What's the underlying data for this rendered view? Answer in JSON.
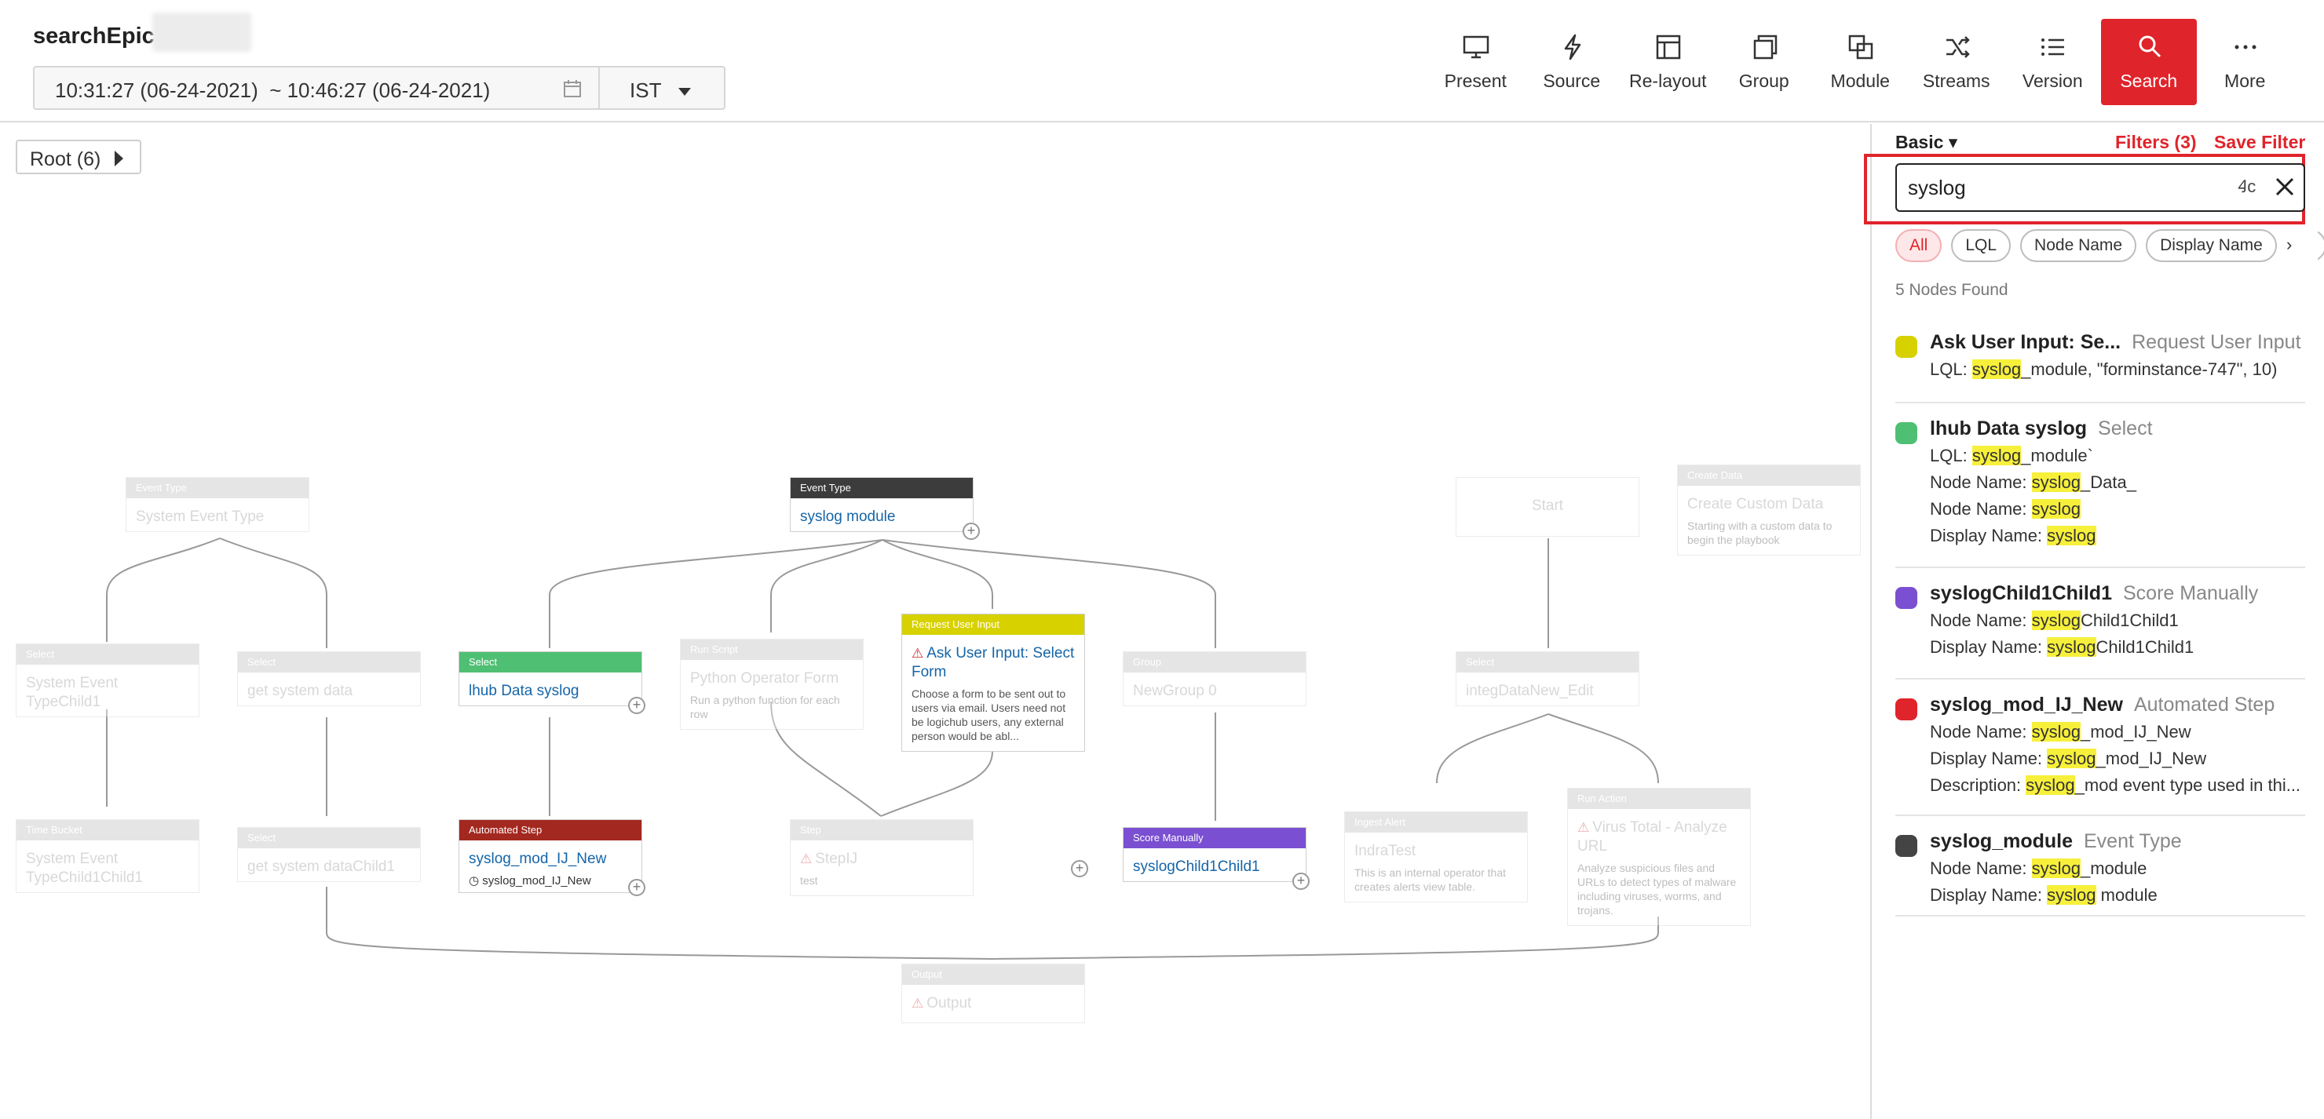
{
  "header": {
    "title": "searchEpic",
    "time_range": "10:31:27 (06-24-2021)  ~ 10:46:27 (06-24-2021)",
    "timezone": "IST",
    "toolbar": [
      {
        "label": "Present",
        "icon": "monitor-icon"
      },
      {
        "label": "Source",
        "icon": "bolt-icon"
      },
      {
        "label": "Re-layout",
        "icon": "layout-icon"
      },
      {
        "label": "Group",
        "icon": "group-icon"
      },
      {
        "label": "Module",
        "icon": "module-icon"
      },
      {
        "label": "Streams",
        "icon": "shuffle-icon"
      },
      {
        "label": "Version",
        "icon": "list-icon"
      },
      {
        "label": "Search",
        "icon": "search-icon",
        "active": true
      },
      {
        "label": "More",
        "icon": "more-icon"
      }
    ]
  },
  "canvas": {
    "breadcrumb": "Root (6)",
    "nodes": {
      "system_event_type": {
        "head": "Event Type",
        "title": "System Event Type"
      },
      "syslog_module": {
        "head": "Event Type",
        "title": "syslog module"
      },
      "start": {
        "title": "Start"
      },
      "create_data": {
        "head": "Create Data",
        "title": "Create Custom Data",
        "desc": "Starting with a custom data to begin the playbook"
      },
      "select_sys1": {
        "head": "Select",
        "title": "System Event TypeChild1"
      },
      "get_system_data": {
        "head": "Select",
        "title": "get system data"
      },
      "lhub_data": {
        "head": "Select",
        "title": "lhub Data syslog"
      },
      "python_op": {
        "head": "Run Script",
        "title": "Python Operator Form",
        "desc": "Run a python function for each row"
      },
      "ask_user": {
        "head": "Request User Input",
        "title": "Ask User Input: Select Form",
        "desc": "Choose a form to be sent out to users via email. Users need not be logichub users, any external person would be abl..."
      },
      "new_group": {
        "head": "Group",
        "title": "NewGroup 0"
      },
      "integ_data": {
        "head": "Select",
        "title": "integDataNew_Edit"
      },
      "time_bucket": {
        "head": "Time Bucket",
        "title": "System Event TypeChild1Child1"
      },
      "get_sys_child": {
        "head": "Select",
        "title": "get system dataChild1"
      },
      "syslog_mod_ij": {
        "head": "Automated Step",
        "title": "syslog_mod_IJ_New",
        "sub": "syslog_mod_IJ_New"
      },
      "step_ij": {
        "head": "Step",
        "title": "StepIJ",
        "desc": "test"
      },
      "score_manually": {
        "head": "Score Manually",
        "title": "syslogChild1Child1"
      },
      "ingest_alert": {
        "head": "Ingest Alert",
        "title": "IndraTest",
        "desc": "This is an internal operator that creates alerts view table."
      },
      "virus_total": {
        "head": "Run Action",
        "title": "Virus Total - Analyze URL",
        "desc": "Analyze suspicious files and URLs to detect types of malware including viruses, worms, and trojans."
      },
      "output": {
        "head": "Output",
        "title": "Output"
      }
    }
  },
  "panel": {
    "tab": "Basic",
    "filters": "Filters (3)",
    "save_filter": "Save Filter",
    "search_value": "syslog",
    "case_toggle": "Ꜭc",
    "chips": [
      "All",
      "LQL",
      "Node Name",
      "Display Name",
      "D"
    ],
    "count": "5 Nodes Found",
    "results": [
      {
        "name": "Ask User Input: Se...",
        "type": "Request User Input",
        "color": "#d8d100",
        "lines": [
          [
            "LQL: ",
            "syslog",
            "_module, \"forminstance-747\", 10)"
          ]
        ]
      },
      {
        "name": "lhub Data syslog",
        "type": "Select",
        "color": "#4fbf73",
        "lines": [
          [
            "LQL: ",
            "syslog",
            "_module`"
          ],
          [
            "Node Name: ",
            "syslog",
            "_Data_"
          ],
          [
            "Node Name: ",
            "syslog",
            ""
          ],
          [
            "Display Name: ",
            "syslog",
            ""
          ]
        ]
      },
      {
        "name": "syslogChild1Child1",
        "type": "Score Manually",
        "color": "#7a4fd1",
        "lines": [
          [
            "Node Name: ",
            "syslog",
            "Child1Child1"
          ],
          [
            "Display Name: ",
            "syslog",
            "Child1Child1"
          ]
        ]
      },
      {
        "name": "syslog_mod_IJ_New",
        "type": "Automated Step",
        "color": "#e0242b",
        "lines": [
          [
            "Node Name: ",
            "syslog",
            "_mod_IJ_New"
          ],
          [
            "Display Name: ",
            "syslog",
            "_mod_IJ_New"
          ],
          [
            "Description: ",
            "syslog",
            "_mod event type used in thi..."
          ]
        ]
      },
      {
        "name": "syslog_module",
        "type": "Event Type",
        "color": "#444444",
        "lines": [
          [
            "Node Name: ",
            "syslog",
            "_module"
          ],
          [
            "Display Name: ",
            "syslog",
            " module"
          ]
        ]
      }
    ]
  },
  "colors": {
    "accent": "#e0242b",
    "select_green": "#4fbf73",
    "request_yellow": "#d8d100",
    "automated_red": "#a3281f",
    "score_purple": "#7a4fd1",
    "event_dark": "#3c3c3c"
  }
}
